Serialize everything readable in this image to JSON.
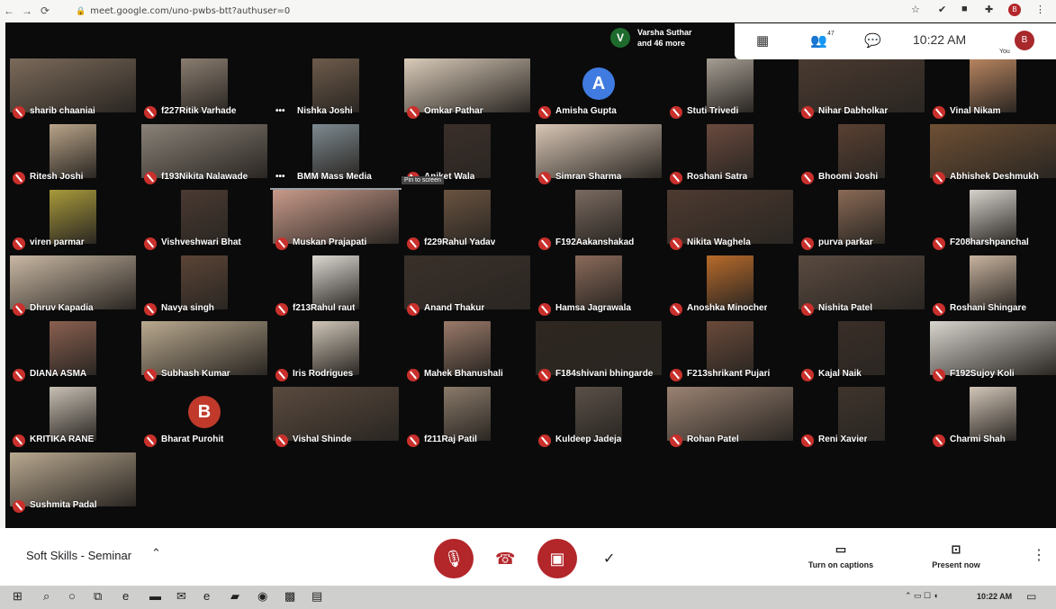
{
  "browser": {
    "url": "meet.google.com/uno-pwbs-btt?authuser=0"
  },
  "presenting": {
    "avatar_letter": "V",
    "line1": "Varsha Suthar",
    "line2": "and 46 more"
  },
  "topbar": {
    "people_count": "47",
    "time": "10:22 AM",
    "you_label": "You",
    "user_initial": "B"
  },
  "participants": [
    {
      "name": "sharib chaaniai",
      "photo": "#7b6a5a"
    },
    {
      "name": "f227Ritik Varhade",
      "photo": "#8a7d70"
    },
    {
      "name": "Nishka Joshi",
      "photo": "#6e5b4b",
      "more": true
    },
    {
      "name": "Omkar Pathar",
      "photo": "#d9cbb9"
    },
    {
      "name": "Amisha Gupta",
      "avatar": "A",
      "avatar_color": "#3f7be0"
    },
    {
      "name": "Stuti Trivedi",
      "photo": "#a59e94"
    },
    {
      "name": "Nihar Dabholkar",
      "photo": "#4a3a30"
    },
    {
      "name": "Vinal Nikam",
      "photo": "#b88560"
    },
    {
      "name": "Ritesh Joshi",
      "photo": "#b9a489"
    },
    {
      "name": "f193Nikita Nalawade",
      "photo": "#8a8278"
    },
    {
      "name": "BMM Mass Media",
      "photo": "#7d8a91",
      "more": true,
      "pinned": true
    },
    {
      "name": "Aniket Wala",
      "photo": "#3b2f2a",
      "pin": "Pin to screen"
    },
    {
      "name": "Simran Sharma",
      "photo": "#d8c6b5"
    },
    {
      "name": "Roshani Satra",
      "photo": "#6b4a3e"
    },
    {
      "name": "Bhoomi Joshi",
      "photo": "#5a4032"
    },
    {
      "name": "Abhishek Deshmukh",
      "photo": "#6f5034"
    },
    {
      "name": "viren parmar",
      "photo": "#a89a3a"
    },
    {
      "name": "Vishveshwari Bhat",
      "photo": "#4a3a32"
    },
    {
      "name": "Muskan Prajapati",
      "photo": "#c89a8a"
    },
    {
      "name": "f229Rahul Yadav",
      "photo": "#6a5340"
    },
    {
      "name": "F192Aakanshakad",
      "photo": "#7a6a60"
    },
    {
      "name": "Nikita Waghela",
      "photo": "#4d3a30"
    },
    {
      "name": "purva parkar",
      "photo": "#8a6a55"
    },
    {
      "name": "F208harshpanchal",
      "photo": "#d6d2cc"
    },
    {
      "name": "Dhruv Kapadia",
      "photo": "#c9b8a4"
    },
    {
      "name": "Navya singh",
      "photo": "#5b4436"
    },
    {
      "name": "f213Rahul raut",
      "photo": "#dcd8d2"
    },
    {
      "name": "Anand Thakur",
      "photo": "#3a302a"
    },
    {
      "name": "Hamsa Jagrawala",
      "photo": "#8a6a5a"
    },
    {
      "name": "Anoshka Minocher",
      "photo": "#b86a2a"
    },
    {
      "name": "Nishita Patel",
      "photo": "#5a4a40"
    },
    {
      "name": "Roshani Shingare",
      "photo": "#c9b4a0"
    },
    {
      "name": "DIANA ASMA",
      "photo": "#8a6050"
    },
    {
      "name": "Subhash Kumar",
      "photo": "#b9a98f"
    },
    {
      "name": "Iris Rodrigues",
      "photo": "#cfc6b8"
    },
    {
      "name": "Mahek Bhanushali",
      "photo": "#9a7a6a"
    },
    {
      "name": "F184shivani bhingarde",
      "photo": "#2e2620"
    },
    {
      "name": "F213shrikant Pujari",
      "photo": "#6a4a3a"
    },
    {
      "name": "Kajal Naik",
      "photo": "#3a2e28"
    },
    {
      "name": "F192Sujoy Koli",
      "photo": "#d8d4ce"
    },
    {
      "name": "KRITIKA RANE",
      "photo": "#c8c0b4"
    },
    {
      "name": "Bharat Purohit",
      "avatar": "B",
      "avatar_color": "#c0392b"
    },
    {
      "name": "Vishal Shinde",
      "photo": "#5a4a3e"
    },
    {
      "name": "f211Raj Patil",
      "photo": "#8a7a6a"
    },
    {
      "name": "Kuldeep Jadeja",
      "photo": "#5a5048"
    },
    {
      "name": "Rohan Patel",
      "photo": "#9a8272"
    },
    {
      "name": "Reni Xavier",
      "photo": "#3e342c"
    },
    {
      "name": "Charmi Shah",
      "photo": "#d2c6b8"
    },
    {
      "name": "Sushmita Padal",
      "photo": "#b8a890"
    }
  ],
  "bottombar": {
    "meeting_name": "Soft Skills - Seminar",
    "captions_label": "Turn on captions",
    "present_label": "Present now"
  },
  "taskbar": {
    "time": "10:22 AM"
  }
}
